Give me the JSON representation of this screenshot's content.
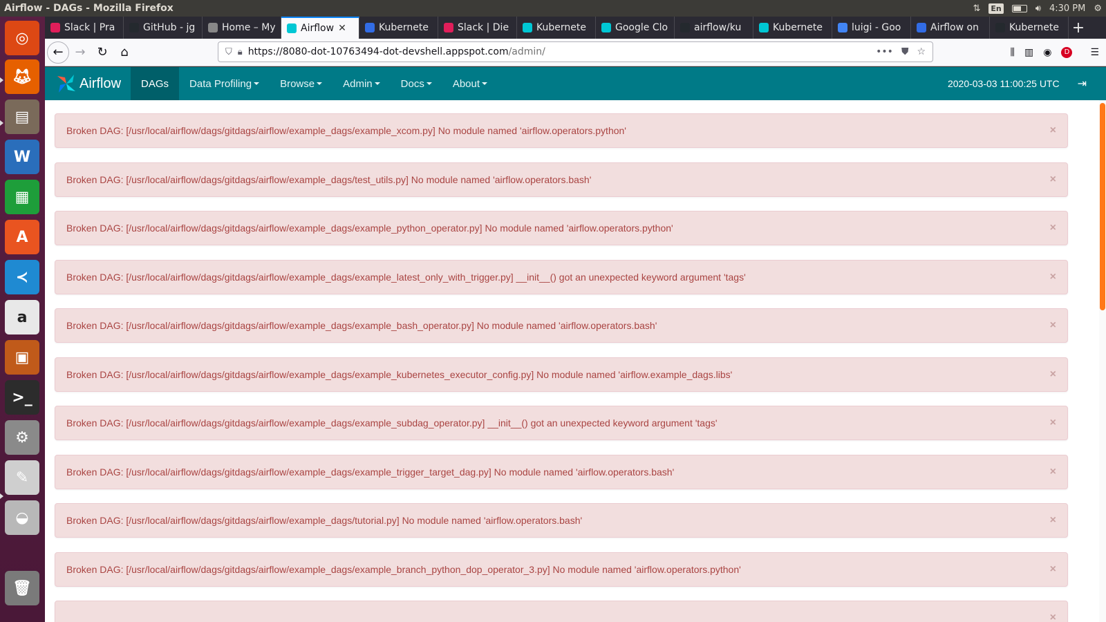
{
  "window": {
    "title": "Airflow - DAGs - Mozilla Firefox",
    "clock": "4:30 PM",
    "keyboard_layout": "En"
  },
  "launcher": {
    "items": [
      "ubuntu-dash",
      "firefox",
      "files",
      "libreoffice-writer",
      "libreoffice-calc",
      "software-center",
      "vscode",
      "amazon",
      "libreoffice-impress",
      "terminal",
      "system-settings",
      "text-editor",
      "disk",
      "trash"
    ]
  },
  "browser": {
    "tabs": [
      {
        "label": "Slack | Pra",
        "icon": "slack-icon",
        "color": "#e01e5a"
      },
      {
        "label": "GitHub - jg",
        "icon": "github-icon",
        "color": "#24292e"
      },
      {
        "label": "Home – My",
        "icon": "jupyter-icon",
        "color": "#888888"
      },
      {
        "label": "Airflow",
        "icon": "airflow-icon",
        "color": "#00c7d4",
        "active": true
      },
      {
        "label": "Kubernete",
        "icon": "kubernetes-icon",
        "color": "#326ce5"
      },
      {
        "label": "Slack | Die",
        "icon": "slack-icon",
        "color": "#e01e5a"
      },
      {
        "label": "Kubernete",
        "icon": "airflow-icon",
        "color": "#00c7d4"
      },
      {
        "label": "Google Clo",
        "icon": "airflow-icon",
        "color": "#00c7d4"
      },
      {
        "label": "airflow/ku",
        "icon": "github-icon",
        "color": "#24292e"
      },
      {
        "label": "Kubernete",
        "icon": "airflow-icon",
        "color": "#00c7d4"
      },
      {
        "label": "luigi - Goo",
        "icon": "google-icon",
        "color": "#4285f4"
      },
      {
        "label": "Airflow on",
        "icon": "kubernetes-icon",
        "color": "#326ce5"
      },
      {
        "label": "Kubernete",
        "icon": "github-icon",
        "color": "#24292e"
      }
    ],
    "url_host": "https://8080-dot-10763494-dot-devshell.appspot.com",
    "url_path": "/admin/"
  },
  "airflow": {
    "brand": "Airflow",
    "menu": [
      {
        "label": "DAGs",
        "active": true,
        "dropdown": false
      },
      {
        "label": "Data Profiling",
        "dropdown": true
      },
      {
        "label": "Browse",
        "dropdown": true
      },
      {
        "label": "Admin",
        "dropdown": true
      },
      {
        "label": "Docs",
        "dropdown": true
      },
      {
        "label": "About",
        "dropdown": true
      }
    ],
    "server_time": "2020-03-03 11:00:25 UTC",
    "alerts": [
      "Broken DAG: [/usr/local/airflow/dags/gitdags/airflow/example_dags/example_xcom.py] No module named 'airflow.operators.python'",
      "Broken DAG: [/usr/local/airflow/dags/gitdags/airflow/example_dags/test_utils.py] No module named 'airflow.operators.bash'",
      "Broken DAG: [/usr/local/airflow/dags/gitdags/airflow/example_dags/example_python_operator.py] No module named 'airflow.operators.python'",
      "Broken DAG: [/usr/local/airflow/dags/gitdags/airflow/example_dags/example_latest_only_with_trigger.py] __init__() got an unexpected keyword argument 'tags'",
      "Broken DAG: [/usr/local/airflow/dags/gitdags/airflow/example_dags/example_bash_operator.py] No module named 'airflow.operators.bash'",
      "Broken DAG: [/usr/local/airflow/dags/gitdags/airflow/example_dags/example_kubernetes_executor_config.py] No module named 'airflow.example_dags.libs'",
      "Broken DAG: [/usr/local/airflow/dags/gitdags/airflow/example_dags/example_subdag_operator.py] __init__() got an unexpected keyword argument 'tags'",
      "Broken DAG: [/usr/local/airflow/dags/gitdags/airflow/example_dags/example_trigger_target_dag.py] No module named 'airflow.operators.bash'",
      "Broken DAG: [/usr/local/airflow/dags/gitdags/airflow/example_dags/tutorial.py] No module named 'airflow.operators.bash'",
      "Broken DAG: [/usr/local/airflow/dags/gitdags/airflow/example_dags/example_branch_python_dop_operator_3.py] No module named 'airflow.operators.python'",
      ""
    ],
    "close_symbol": "×"
  }
}
